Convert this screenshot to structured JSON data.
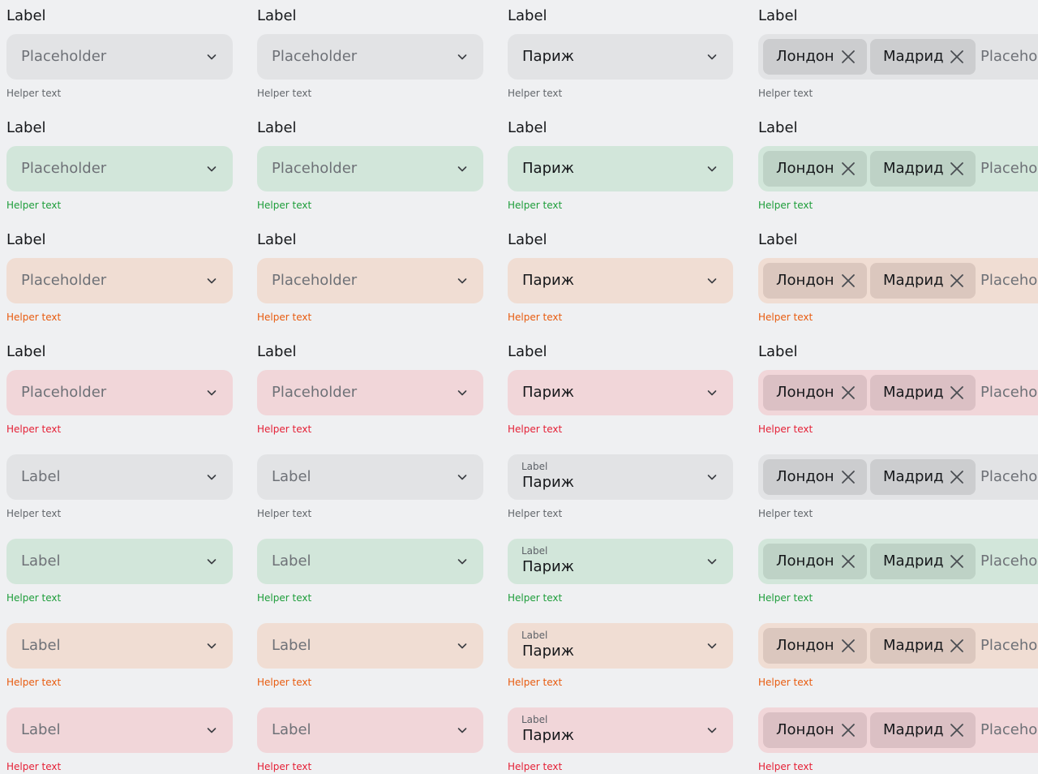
{
  "common": {
    "label": "Label",
    "placeholder": "Placeholder",
    "helper": "Helper text",
    "value": "Париж",
    "chips": [
      "Лондон",
      "Мадрид"
    ]
  },
  "states": [
    {
      "name": "default",
      "field_bg": "#e2e3e5",
      "chip_bg": "#cccdcf",
      "helper_color": "#62666b"
    },
    {
      "name": "success",
      "field_bg": "#d2e6da",
      "chip_bg": "#bed2c6",
      "helper_color": "#1d9d3a"
    },
    {
      "name": "warning",
      "field_bg": "#f0ddd3",
      "chip_bg": "#dbc7be",
      "helper_color": "#e85b0f"
    },
    {
      "name": "error",
      "field_bg": "#f1d6d9",
      "chip_bg": "#dbc0c4",
      "helper_color": "#e51f35"
    }
  ],
  "icons": {
    "dropdown": "chevron-down-icon",
    "remove": "close-icon"
  }
}
